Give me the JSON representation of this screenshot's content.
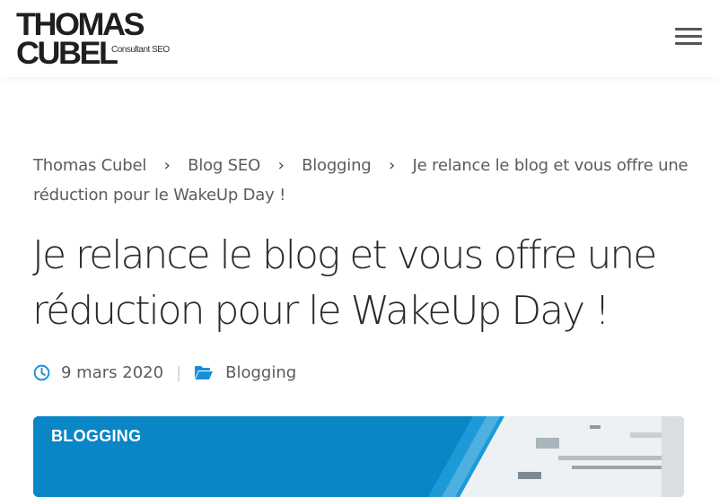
{
  "header": {
    "logo": {
      "line1": "THOMAS",
      "line2": "CUBEL",
      "tagline": "Consultant SEO"
    },
    "menu_icon": "hamburger-menu-icon"
  },
  "breadcrumb": [
    {
      "label": "Thomas Cubel"
    },
    {
      "label": "Blog SEO"
    },
    {
      "label": "Blogging"
    },
    {
      "label": "Je relance le blog et vous offre une réduction pour le WakeUp Day !"
    }
  ],
  "breadcrumb_separator": "›",
  "article": {
    "title": "Je relance le blog et vous offre une réduction pour le WakeUp Day !",
    "date": "9 mars 2020",
    "meta_divider": "|",
    "category": "Blogging",
    "featured_badge": "BLOGGING"
  },
  "colors": {
    "accent": "#1a8fd8",
    "banner": "#0a86c7"
  },
  "icons": {
    "date": "clock-icon",
    "category": "folder-open-icon"
  }
}
